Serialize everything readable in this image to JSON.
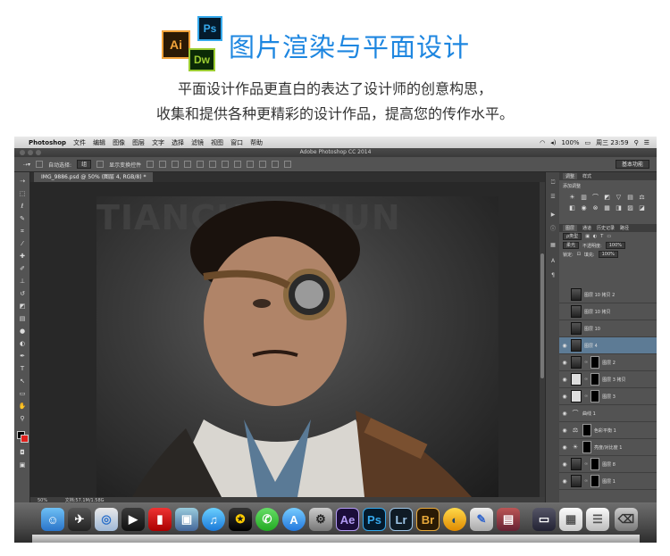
{
  "banner": {
    "title": "图片渲染与平面设计",
    "line1": "平面设计作品更直白的表达了设计师的创意构思，",
    "line2": "收集和提供各种更精彩的设计作品，提高您的传作水平。",
    "logo_ai": "Ai",
    "logo_ps": "Ps",
    "logo_dw": "Dw"
  },
  "menubar": {
    "app_name": "Photoshop",
    "items": [
      "文件",
      "编辑",
      "图像",
      "图层",
      "文字",
      "选择",
      "滤镜",
      "视图",
      "窗口",
      "帮助"
    ],
    "battery": "100%",
    "clock": "周三 23:59"
  },
  "window": {
    "title": "Adobe Photoshop CC 2014"
  },
  "options": {
    "auto_select_label": "自动选择:",
    "auto_select_value": "组",
    "show_transform_label": "显示变换控件",
    "workspace": "基本功能"
  },
  "document": {
    "tab": "IMG_9886.psd @ 50% (图层 4, RGB/8) *",
    "watermark": "TIANCHUANJUN",
    "zoom": "50%",
    "doc_size": "文档:57.1M/1.58G"
  },
  "panels": {
    "tab_adjust": "调整",
    "tab_style": "样式",
    "add_adjust": "添加调整",
    "layer_tabs": [
      "图层",
      "通道",
      "历史记录",
      "路径"
    ],
    "kind_filter": "ρ类型",
    "blend_mode": "柔光",
    "opacity_label": "不透明度:",
    "opacity_value": "100%",
    "lock_label": "锁定:",
    "fill_label": "填充:",
    "fill_value": "100%"
  },
  "layers": [
    {
      "name": "图层 10 拷贝 2"
    },
    {
      "name": "图层 10 拷贝"
    },
    {
      "name": "图层 10"
    },
    {
      "name": "图层 4"
    },
    {
      "name": "图层 2"
    },
    {
      "name": "图层 3 拷贝"
    },
    {
      "name": "图层 3"
    },
    {
      "name": "曲线 1"
    },
    {
      "name": "色彩平衡 1"
    },
    {
      "name": "亮度/对比度 1"
    },
    {
      "name": "图层 8"
    },
    {
      "name": "图层 1"
    }
  ],
  "dock": {
    "app_labels": [
      "Ae",
      "Ps",
      "Lr",
      "Br"
    ]
  },
  "colors": {
    "title_blue": "#1d86e0",
    "selected_layer": "#5d7b95",
    "foreground": "#000000",
    "background": "#e0201c"
  }
}
